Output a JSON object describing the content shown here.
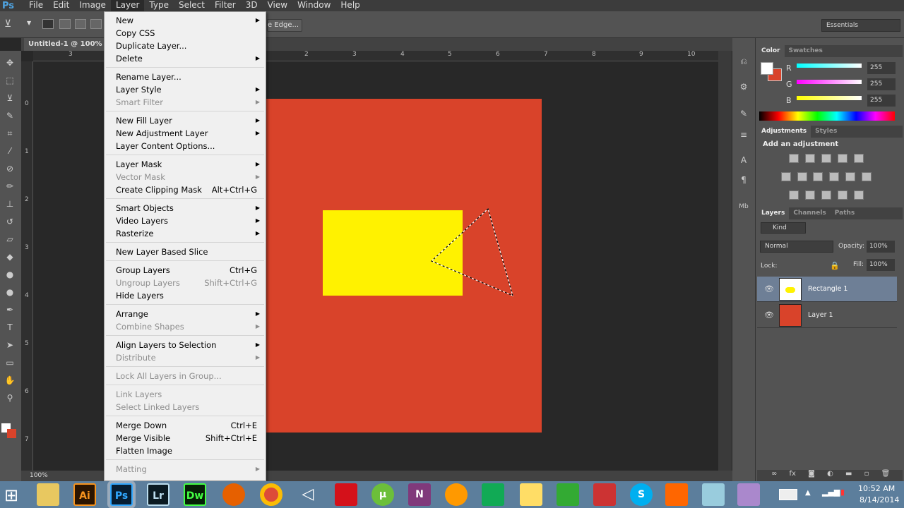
{
  "app": {
    "logo": "Ps"
  },
  "menubar": [
    "File",
    "Edit",
    "Image",
    "Layer",
    "Type",
    "Select",
    "Filter",
    "3D",
    "View",
    "Window",
    "Help"
  ],
  "options": {
    "refine_edge": "e Edge...",
    "workspace": "Essentials"
  },
  "document": {
    "tab": "Untitled-1 @ 100% (R",
    "zoom": "100%"
  },
  "rulers": {
    "h": [
      "2",
      "3",
      "4",
      "5",
      "6",
      "7",
      "8",
      "9",
      "10"
    ],
    "h_left": "3",
    "v": [
      "0",
      "1",
      "2",
      "3",
      "4",
      "5",
      "6",
      "7"
    ]
  },
  "layer_menu": [
    {
      "label": "New",
      "arrow": true
    },
    {
      "label": "Copy CSS"
    },
    {
      "label": "Duplicate Layer..."
    },
    {
      "label": "Delete",
      "arrow": true
    },
    {
      "label": "Rename Layer..."
    },
    {
      "label": "Layer Style",
      "arrow": true
    },
    {
      "label": "Smart Filter",
      "arrow": true,
      "disabled": true
    },
    {
      "label": "New Fill Layer",
      "arrow": true
    },
    {
      "label": "New Adjustment Layer",
      "arrow": true
    },
    {
      "label": "Layer Content Options..."
    },
    {
      "label": "Layer Mask",
      "arrow": true
    },
    {
      "label": "Vector Mask",
      "arrow": true,
      "disabled": true
    },
    {
      "label": "Create Clipping Mask",
      "shortcut": "Alt+Ctrl+G"
    },
    {
      "label": "Smart Objects",
      "arrow": true
    },
    {
      "label": "Video Layers",
      "arrow": true
    },
    {
      "label": "Rasterize",
      "arrow": true
    },
    {
      "label": "New Layer Based Slice"
    },
    {
      "label": "Group Layers",
      "shortcut": "Ctrl+G"
    },
    {
      "label": "Ungroup Layers",
      "shortcut": "Shift+Ctrl+G",
      "disabled": true
    },
    {
      "label": "Hide Layers"
    },
    {
      "label": "Arrange",
      "arrow": true
    },
    {
      "label": "Combine Shapes",
      "arrow": true,
      "disabled": true
    },
    {
      "label": "Align Layers to Selection",
      "arrow": true
    },
    {
      "label": "Distribute",
      "arrow": true,
      "disabled": true
    },
    {
      "label": "Lock All Layers in Group...",
      "disabled": true
    },
    {
      "label": "Link Layers",
      "disabled": true
    },
    {
      "label": "Select Linked Layers",
      "disabled": true
    },
    {
      "label": "Merge Down",
      "shortcut": "Ctrl+E"
    },
    {
      "label": "Merge Visible",
      "shortcut": "Shift+Ctrl+E"
    },
    {
      "label": "Flatten Image"
    },
    {
      "label": "Matting",
      "arrow": true,
      "disabled": true
    }
  ],
  "color_panel": {
    "tabs": [
      "Color",
      "Swatches"
    ],
    "channels": [
      {
        "label": "R",
        "value": "255"
      },
      {
        "label": "G",
        "value": "255"
      },
      {
        "label": "B",
        "value": "255"
      }
    ],
    "foreground": "#ffffff",
    "background": "#d9432a"
  },
  "adjustments_panel": {
    "tabs": [
      "Adjustments",
      "Styles"
    ],
    "heading": "Add an adjustment"
  },
  "layers_panel": {
    "tabs": [
      "Layers",
      "Channels",
      "Paths"
    ],
    "filter": "Kind",
    "blend_mode": "Normal",
    "opacity_label": "Opacity:",
    "opacity": "100%",
    "lock_label": "Lock:",
    "fill_label": "Fill:",
    "fill": "100%",
    "layers": [
      {
        "name": "Rectangle 1",
        "selected": true
      },
      {
        "name": "Layer 1"
      }
    ]
  },
  "canvas": {
    "background_color": "#d9432a",
    "shape_color": "#fff200"
  },
  "taskbar": {
    "apps": [
      "Ai",
      "Ps",
      "Lr",
      "Dw"
    ],
    "time": "10:52 AM",
    "date": "8/14/2014"
  }
}
